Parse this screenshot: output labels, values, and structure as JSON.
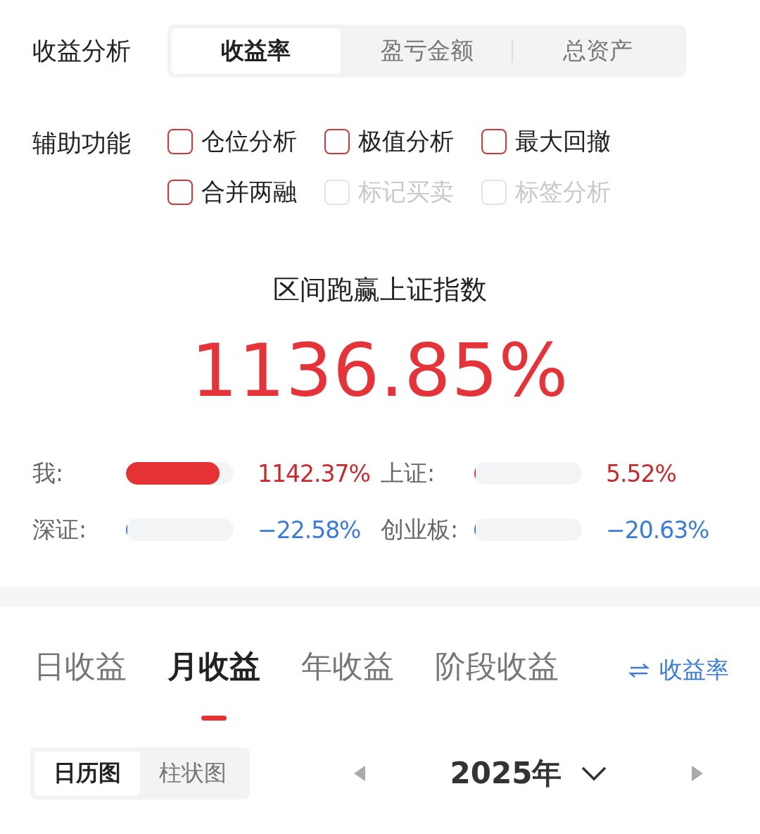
{
  "analysis": {
    "label": "收益分析",
    "tabs": [
      {
        "label": "收益率",
        "selected": true
      },
      {
        "label": "盈亏金额",
        "selected": false
      },
      {
        "label": "总资产",
        "selected": false
      }
    ]
  },
  "aux": {
    "label": "辅助功能",
    "options": [
      {
        "label": "仓位分析",
        "checked": false,
        "disabled": false
      },
      {
        "label": "极值分析",
        "checked": false,
        "disabled": false
      },
      {
        "label": "最大回撤",
        "checked": false,
        "disabled": false
      },
      {
        "label": "合并两融",
        "checked": false,
        "disabled": false
      },
      {
        "label": "标记买卖",
        "checked": false,
        "disabled": true
      },
      {
        "label": "标签分析",
        "checked": false,
        "disabled": true
      }
    ]
  },
  "summary": {
    "title": "区间跑赢上证指数",
    "value": "1136.85%"
  },
  "compare": [
    {
      "name": "我:",
      "level": 0.87,
      "reading": "1142.37%",
      "kind": "gain"
    },
    {
      "name": "上证:",
      "level": 0.01,
      "reading": "5.52%",
      "kind": "gain"
    },
    {
      "name": "深证:",
      "level": 0.01,
      "reading": "−22.58%",
      "kind": "loss"
    },
    {
      "name": "创业板:",
      "level": 0.01,
      "reading": "−20.63%",
      "kind": "loss"
    }
  ],
  "period_tabs": [
    {
      "label": "日收益",
      "selected": false
    },
    {
      "label": "月收益",
      "selected": true
    },
    {
      "label": "年收益",
      "selected": false
    },
    {
      "label": "阶段收益",
      "selected": false
    }
  ],
  "switch": {
    "label": "收益率"
  },
  "views": [
    {
      "label": "日历图",
      "selected": true
    },
    {
      "label": "柱状图",
      "selected": false
    }
  ],
  "year": {
    "label": "2025年"
  }
}
